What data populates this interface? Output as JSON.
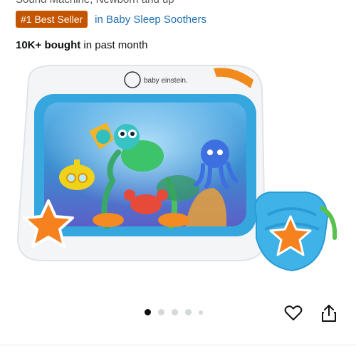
{
  "header": {
    "subtitle_cut": "Sound Machine, Newborn and up",
    "badge": "#1 Best Seller",
    "badge_category": "in Baby Sleep Soothers",
    "bought_bold": "10K+ bought",
    "bought_rest": " in past month"
  },
  "product_image": {
    "brand_logo_text": "baby einstein."
  },
  "carousel": {
    "dots": [
      "active",
      "inactive",
      "inactive",
      "inactive",
      "inactive-small"
    ]
  },
  "actions": {
    "favorite_icon": "heart-icon",
    "share_icon": "share-icon"
  },
  "colors": {
    "badge_bg": "#c45500",
    "link": "#1f6fb2"
  }
}
